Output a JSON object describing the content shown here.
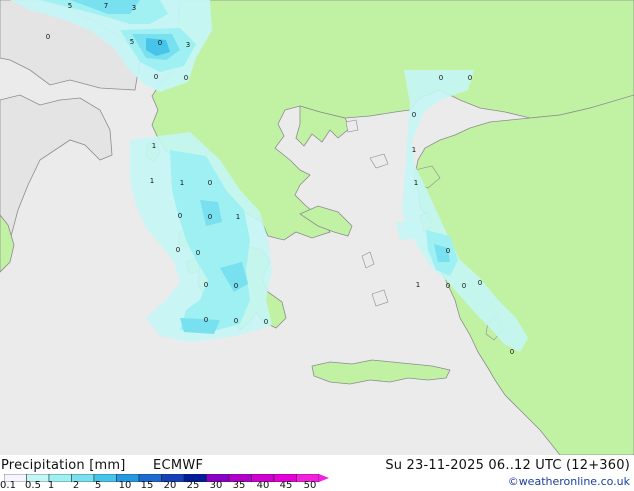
{
  "map": {
    "region": "Greece / Aegean Sea",
    "colors": {
      "sea": "#ebebeb",
      "land_forecast": "#c1f2a4",
      "land_outside": "#e4e4e4",
      "coast": "#8c8c8c"
    },
    "value_labels": [
      "5",
      "7",
      "3",
      "0",
      "5",
      "0",
      "3",
      "0",
      "0",
      "0",
      "0",
      "0",
      "1",
      "1",
      "1",
      "1",
      "0",
      "1",
      "0",
      "0",
      "1",
      "0",
      "0",
      "0",
      "0",
      "1",
      "0",
      "0",
      "0",
      "0",
      "0",
      "0",
      "0",
      "0"
    ]
  },
  "legend": {
    "title": "Precipitation [mm]",
    "model": "ECMWF",
    "ticks": [
      "0.1",
      "0.5",
      "1",
      "2",
      "5",
      "10",
      "15",
      "20",
      "25",
      "30",
      "35",
      "40",
      "45",
      "50"
    ],
    "colors": [
      "#f5f5ff",
      "#c5f6f6",
      "#9ff0f2",
      "#78e0ef",
      "#46c4e9",
      "#2399e0",
      "#1b6bd0",
      "#1640b8",
      "#001c9c",
      "#8b00c6",
      "#b200cc",
      "#d000d0",
      "#e400d8",
      "#f420e0"
    ],
    "arrow_color": "#f420e0"
  },
  "validity": "Su 23-11-2025 06..12 UTC (12+360)",
  "credit": "©weatheronline.co.uk"
}
